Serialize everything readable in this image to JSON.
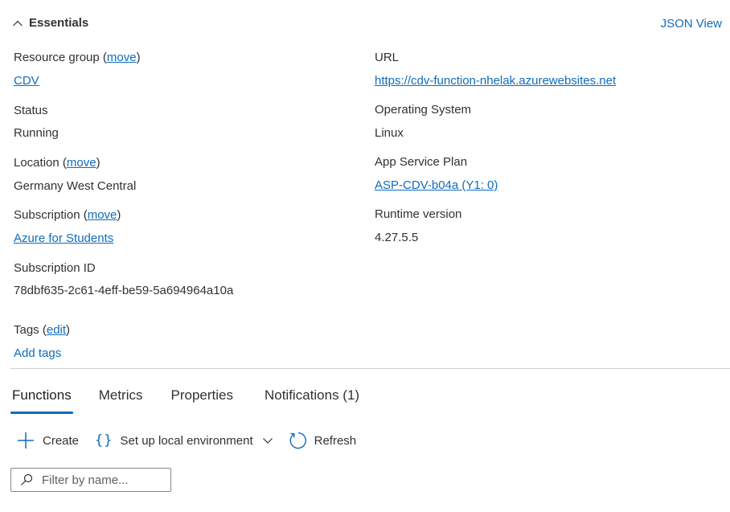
{
  "essentials": {
    "title": "Essentials",
    "json_view_label": "JSON View"
  },
  "left_column": {
    "resource_group_label": "Resource group",
    "resource_group_move": "move",
    "resource_group_value": "CDV",
    "status_label": "Status",
    "status_value": "Running",
    "location_label": "Location",
    "location_move": "move",
    "location_value": "Germany West Central",
    "subscription_label": "Subscription",
    "subscription_move": "move",
    "subscription_value": "Azure for Students",
    "subscription_id_label": "Subscription ID",
    "subscription_id_value": "78dbf635-2c61-4eff-be59-5a694964a10a"
  },
  "right_column": {
    "url_label": "URL",
    "url_value": "https://cdv-function-nhelak.azurewebsites.net",
    "os_label": "Operating System",
    "os_value": "Linux",
    "plan_label": "App Service Plan",
    "plan_value": "ASP-CDV-b04a (Y1: 0)",
    "runtime_label": "Runtime version",
    "runtime_value": "4.27.5.5"
  },
  "tags": {
    "label": "Tags",
    "edit": "edit",
    "add": "Add tags"
  },
  "tabs": [
    {
      "label": "Functions",
      "active": true
    },
    {
      "label": "Metrics",
      "active": false
    },
    {
      "label": "Properties",
      "active": false
    },
    {
      "label": "Notifications (1)",
      "active": false
    }
  ],
  "toolbar": {
    "create_label": "Create",
    "local_env_label": "Set up local environment",
    "refresh_label": "Refresh"
  },
  "filter": {
    "placeholder": "Filter by name...",
    "value": ""
  },
  "colors": {
    "link": "#0f6cbd",
    "text": "#323130",
    "divider": "#d2d0ce"
  }
}
